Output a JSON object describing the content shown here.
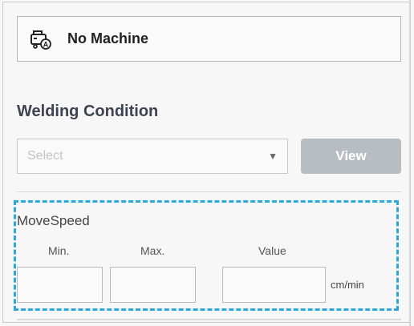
{
  "machine": {
    "label": "No Machine",
    "icon": "machine-auto-icon"
  },
  "welding": {
    "title": "Welding Condition",
    "select_placeholder": "Select",
    "view_label": "View"
  },
  "param": {
    "name": "MoveSpeed",
    "min_label": "Min.",
    "max_label": "Max.",
    "value_label": "Value",
    "min_value": "",
    "max_value": "",
    "value": "",
    "unit": "cm/min"
  },
  "colors": {
    "highlight_border": "#29a8d9",
    "view_button_bg": "#b8bcc3",
    "title_text": "#3d4350"
  }
}
